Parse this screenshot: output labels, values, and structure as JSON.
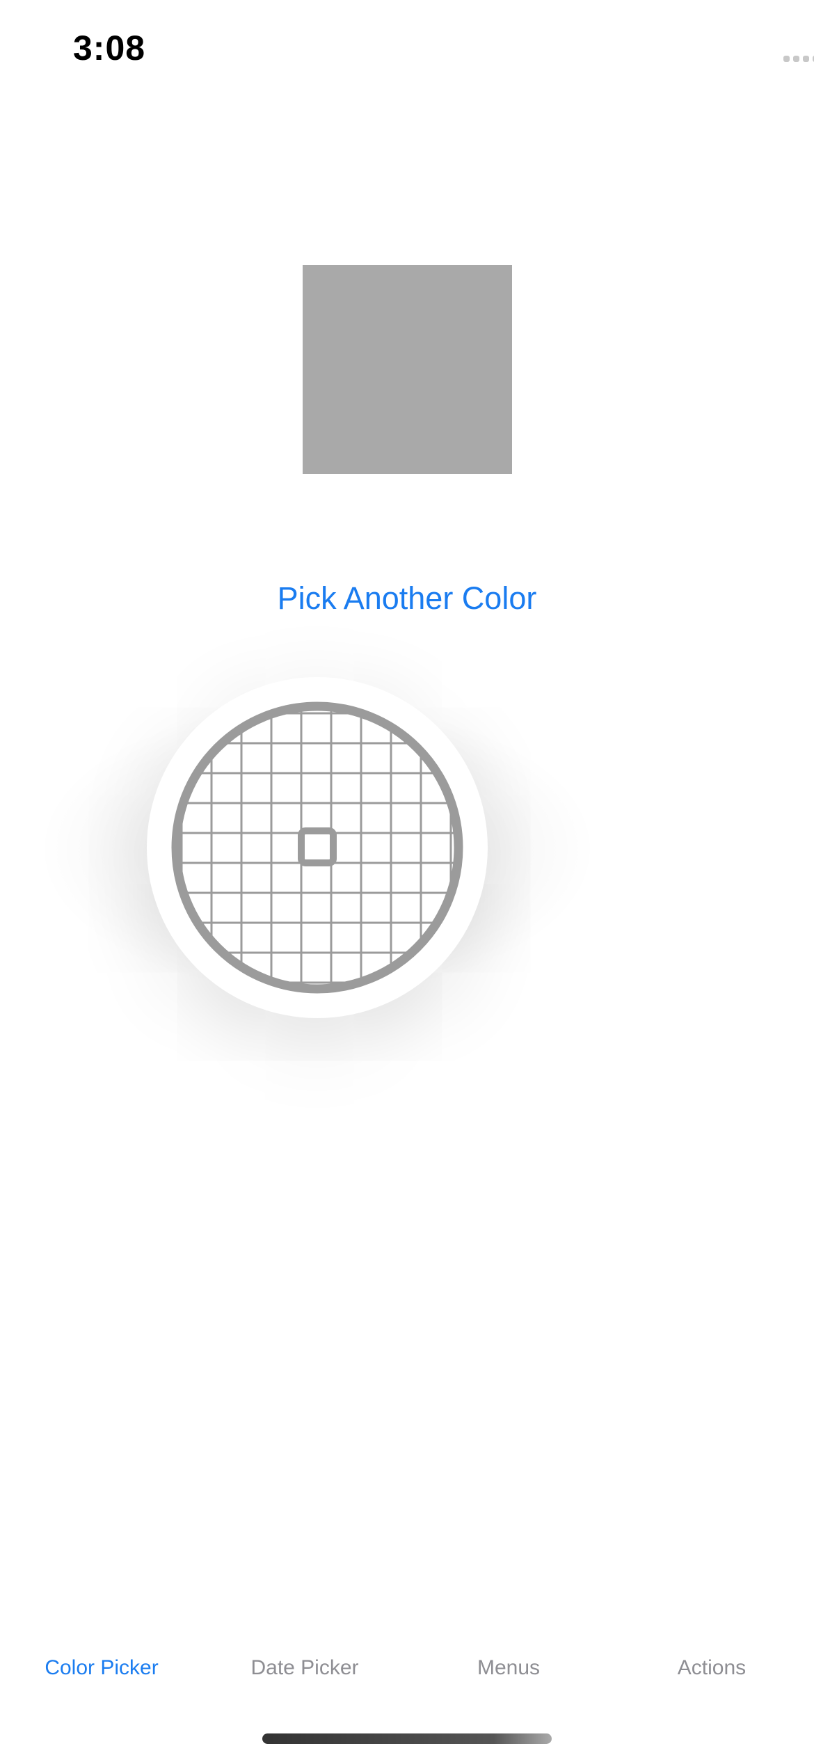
{
  "status_bar": {
    "time": "3:08",
    "icons": [
      "cellular-signal-icon",
      "wifi-icon",
      "battery-icon"
    ]
  },
  "color_preview": {
    "swatch_color": "#a9a9a9"
  },
  "pick_button": {
    "label": "Pick Another Color"
  },
  "loupe": {
    "grid_color": "#9b9b9b",
    "icon": "eyedropper-loupe-icon"
  },
  "tab_bar": {
    "tabs": [
      {
        "label": "Color Picker",
        "active": true
      },
      {
        "label": "Date Picker",
        "active": false
      },
      {
        "label": "Menus",
        "active": false
      },
      {
        "label": "Actions",
        "active": false
      }
    ],
    "active_color": "#1a7cf0",
    "inactive_color": "#8e8e93"
  }
}
